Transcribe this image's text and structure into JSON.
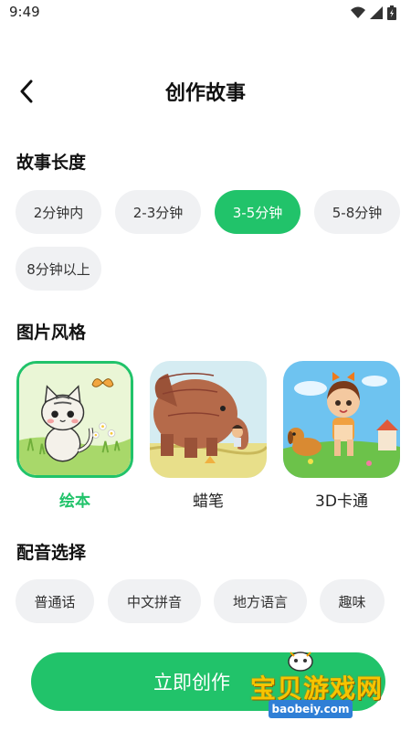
{
  "status_bar": {
    "time": "9:49"
  },
  "header": {
    "title": "创作故事"
  },
  "story_length": {
    "title": "故事长度",
    "options": [
      "2分钟内",
      "2-3分钟",
      "3-5分钟",
      "5-8分钟",
      "8分钟以上"
    ],
    "selected": "3-5分钟"
  },
  "image_style": {
    "title": "图片风格",
    "options": [
      {
        "label": "绘本",
        "icon": "picture-book-cat-thumbnail"
      },
      {
        "label": "蜡笔",
        "icon": "crayon-elephant-thumbnail"
      },
      {
        "label": "3D卡通",
        "icon": "3d-cartoon-girl-dog-thumbnail"
      }
    ],
    "selected": "绘本"
  },
  "voice": {
    "title": "配音选择",
    "options": [
      "普通话",
      "中文拼音",
      "地方语言",
      "趣味"
    ]
  },
  "create_button": {
    "label": "立即创作"
  },
  "watermark": {
    "text": "宝贝游戏网",
    "url": "baobeiy.com"
  },
  "colors": {
    "accent": "#21c36a",
    "chip_bg": "#f0f1f3"
  }
}
